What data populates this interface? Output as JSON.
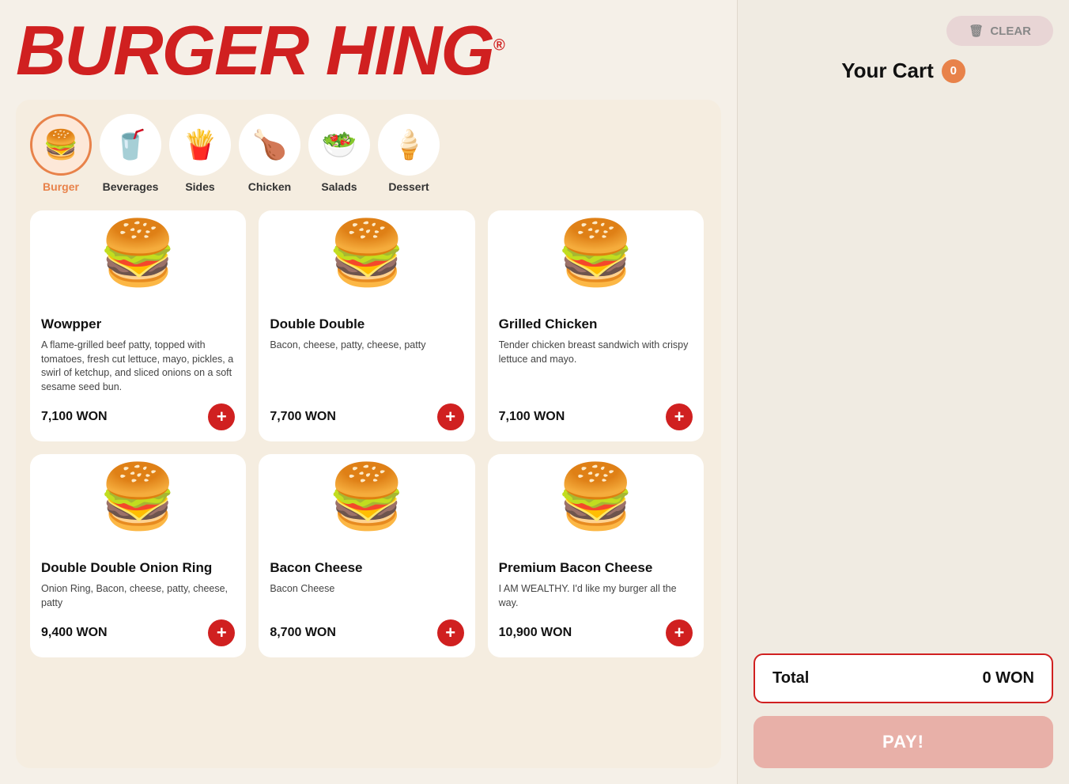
{
  "logo": {
    "text": "BURGER HING",
    "registered": "®"
  },
  "categories": [
    {
      "id": "burger",
      "label": "Burger",
      "icon": "🍔",
      "active": true
    },
    {
      "id": "beverages",
      "label": "Beverages",
      "icon": "🥤",
      "active": false
    },
    {
      "id": "sides",
      "label": "Sides",
      "icon": "🍟",
      "active": false
    },
    {
      "id": "chicken",
      "label": "Chicken",
      "icon": "🍗",
      "active": false
    },
    {
      "id": "salads",
      "label": "Salads",
      "icon": "🥗",
      "active": false
    },
    {
      "id": "dessert",
      "label": "Dessert",
      "icon": "🍦",
      "active": false
    }
  ],
  "menu_items": [
    {
      "id": 1,
      "name": "Wowpper",
      "description": "A flame-grilled beef patty, topped with tomatoes, fresh cut lettuce, mayo, pickles, a swirl of ketchup, and sliced onions on a soft sesame seed bun.",
      "price": "7,100 WON",
      "icon": "🍔"
    },
    {
      "id": 2,
      "name": "Double Double",
      "description": "Bacon, cheese, patty, cheese, patty",
      "price": "7,700 WON",
      "icon": "🍔"
    },
    {
      "id": 3,
      "name": "Grilled Chicken",
      "description": "Tender chicken breast sandwich with crispy lettuce and mayo.",
      "price": "7,100 WON",
      "icon": "🍔"
    },
    {
      "id": 4,
      "name": "Double Double Onion Ring",
      "description": "Onion Ring, Bacon, cheese, patty, cheese, patty",
      "price": "9,400 WON",
      "icon": "🍔"
    },
    {
      "id": 5,
      "name": "Bacon Cheese",
      "description": "Bacon Cheese",
      "price": "8,700 WON",
      "icon": "🍔"
    },
    {
      "id": 6,
      "name": "Premium Bacon Cheese",
      "description": "I AM WEALTHY. I'd like my burger all the way.",
      "price": "10,900 WON",
      "icon": "🍔"
    }
  ],
  "cart": {
    "title": "Your Cart",
    "count": 0,
    "total_label": "Total",
    "total_value": "0 WON",
    "clear_label": "CLEAR",
    "pay_label": "PAY!"
  }
}
